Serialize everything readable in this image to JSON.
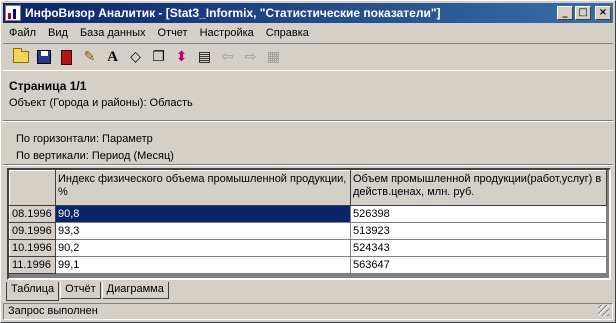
{
  "window": {
    "title": "ИнфоВизор Аналитик - [Stat3_Informix, \"Статистические показатели\"]"
  },
  "titlebar_buttons": {
    "minimize": "_",
    "maximize": "□",
    "close": "×"
  },
  "menu": [
    "Файл",
    "Вид",
    "База данных",
    "Отчет",
    "Настройка",
    "Справка"
  ],
  "toolbar": {
    "icons": [
      "open-folder-icon",
      "save-disk-icon",
      "book-icon",
      "pen-icon",
      "font-A-icon",
      "eraser-icon",
      "copy-window-icon",
      "sort-arrows-icon",
      "properties-icon",
      "back-arrow-icon",
      "forward-arrow-icon",
      "calculator-icon"
    ]
  },
  "page_info": {
    "page": "Страница 1/1",
    "object": "Объект (Города и районы): Область"
  },
  "axes_info": {
    "horizontal": "По горизонтали: Параметр",
    "vertical": "По вертикали: Период (Месяц)"
  },
  "table": {
    "columns": [
      "Индекс физического объема промышленной продукции, %",
      "Объем промышленной продукции(работ,услуг) в действ.ценах, млн. руб."
    ],
    "rows": [
      {
        "period": "08.1996",
        "v1": "90,8",
        "v2": "526398"
      },
      {
        "period": "09.1996",
        "v1": "93,3",
        "v2": "513923"
      },
      {
        "period": "10.1996",
        "v1": "90,2",
        "v2": "524343"
      },
      {
        "period": "11.1996",
        "v1": "99,1",
        "v2": "563647"
      }
    ]
  },
  "tabs": [
    "Таблица",
    "Отчёт",
    "Диаграмма"
  ],
  "status": "Запрос выполнен",
  "colors": {
    "titlebar": "#0a246a",
    "selection": "#0a246a",
    "face": "#d4d0c8"
  }
}
